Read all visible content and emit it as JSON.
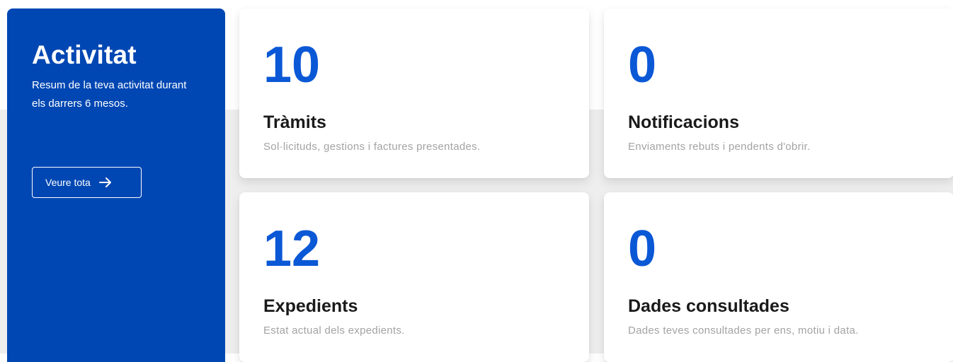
{
  "activity": {
    "title": "Activitat",
    "subtitle": "Resum de la teva activitat durant els darrers 6 mesos.",
    "view_all_label": "Veure tota",
    "view_all_icon": "arrow-right-icon"
  },
  "cards": [
    {
      "number": "10",
      "title": "Tràmits",
      "description": "Sol·licituds, gestions i factures presentades."
    },
    {
      "number": "0",
      "title": "Notificacions",
      "description": "Enviaments rebuts i pendents d'obrir."
    },
    {
      "number": "12",
      "title": "Expedients",
      "description": "Estat actual dels expedients."
    },
    {
      "number": "0",
      "title": "Dades consultades",
      "description": "Dades teves consultades per ens, motiu i data."
    }
  ],
  "colors": {
    "panel": "#0047b3",
    "accent_number": "#0b58d6",
    "title_text": "#1a1a1a",
    "desc_text": "#a3a3a3"
  }
}
